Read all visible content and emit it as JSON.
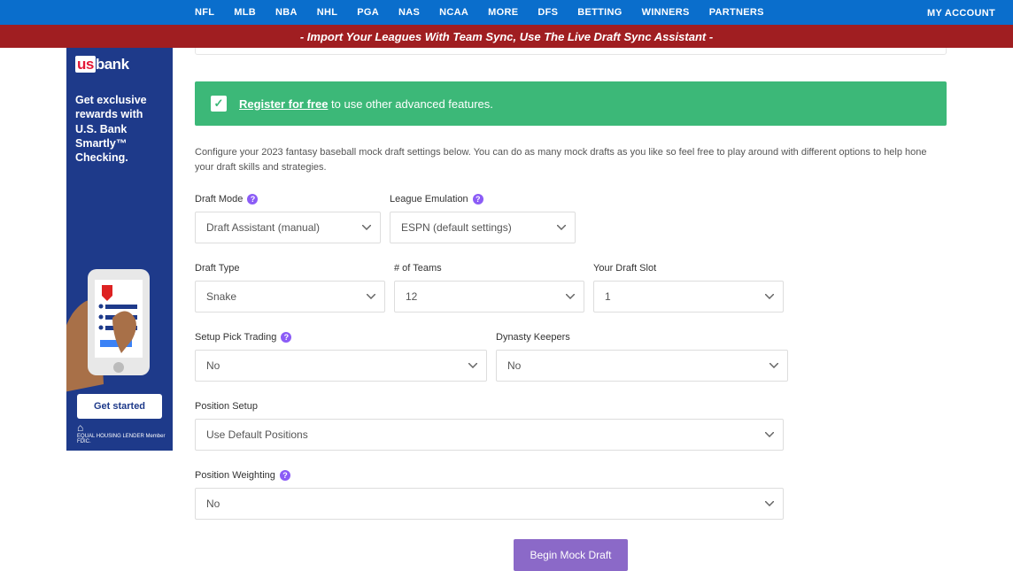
{
  "nav": {
    "items": [
      "NFL",
      "MLB",
      "NBA",
      "NHL",
      "PGA",
      "NAS",
      "NCAA",
      "MORE",
      "DFS",
      "BETTING",
      "WINNERS",
      "PARTNERS"
    ],
    "account": "MY ACCOUNT"
  },
  "promo": "- Import Your Leagues With Team Sync, Use The Live Draft Sync Assistant -",
  "ad": {
    "brand_us": "us",
    "brand_bank": "bank",
    "copy": "Get exclusive rewards with U.S. Bank Smartly™ Checking.",
    "cta": "Get started",
    "fdic": "EQUAL HOUSING LENDER Member FDIC."
  },
  "alert": {
    "link": "Register for free",
    "rest": " to use other advanced features."
  },
  "desc": "Configure your 2023 fantasy baseball mock draft settings below. You can do as many mock drafts as you like so feel free to play around with different options to help hone your draft skills and strategies.",
  "form": {
    "draft_mode": {
      "label": "Draft Mode",
      "value": "Draft Assistant (manual)"
    },
    "league_emulation": {
      "label": "League Emulation",
      "value": "ESPN (default settings)"
    },
    "draft_type": {
      "label": "Draft Type",
      "value": "Snake"
    },
    "num_teams": {
      "label": "# of Teams",
      "value": "12"
    },
    "draft_slot": {
      "label": "Your Draft Slot",
      "value": "1"
    },
    "pick_trading": {
      "label": "Setup Pick Trading",
      "value": "No"
    },
    "dynasty": {
      "label": "Dynasty Keepers",
      "value": "No"
    },
    "position_setup": {
      "label": "Position Setup",
      "value": "Use Default Positions"
    },
    "position_weighting": {
      "label": "Position Weighting",
      "value": "No"
    },
    "submit": "Begin Mock Draft"
  }
}
